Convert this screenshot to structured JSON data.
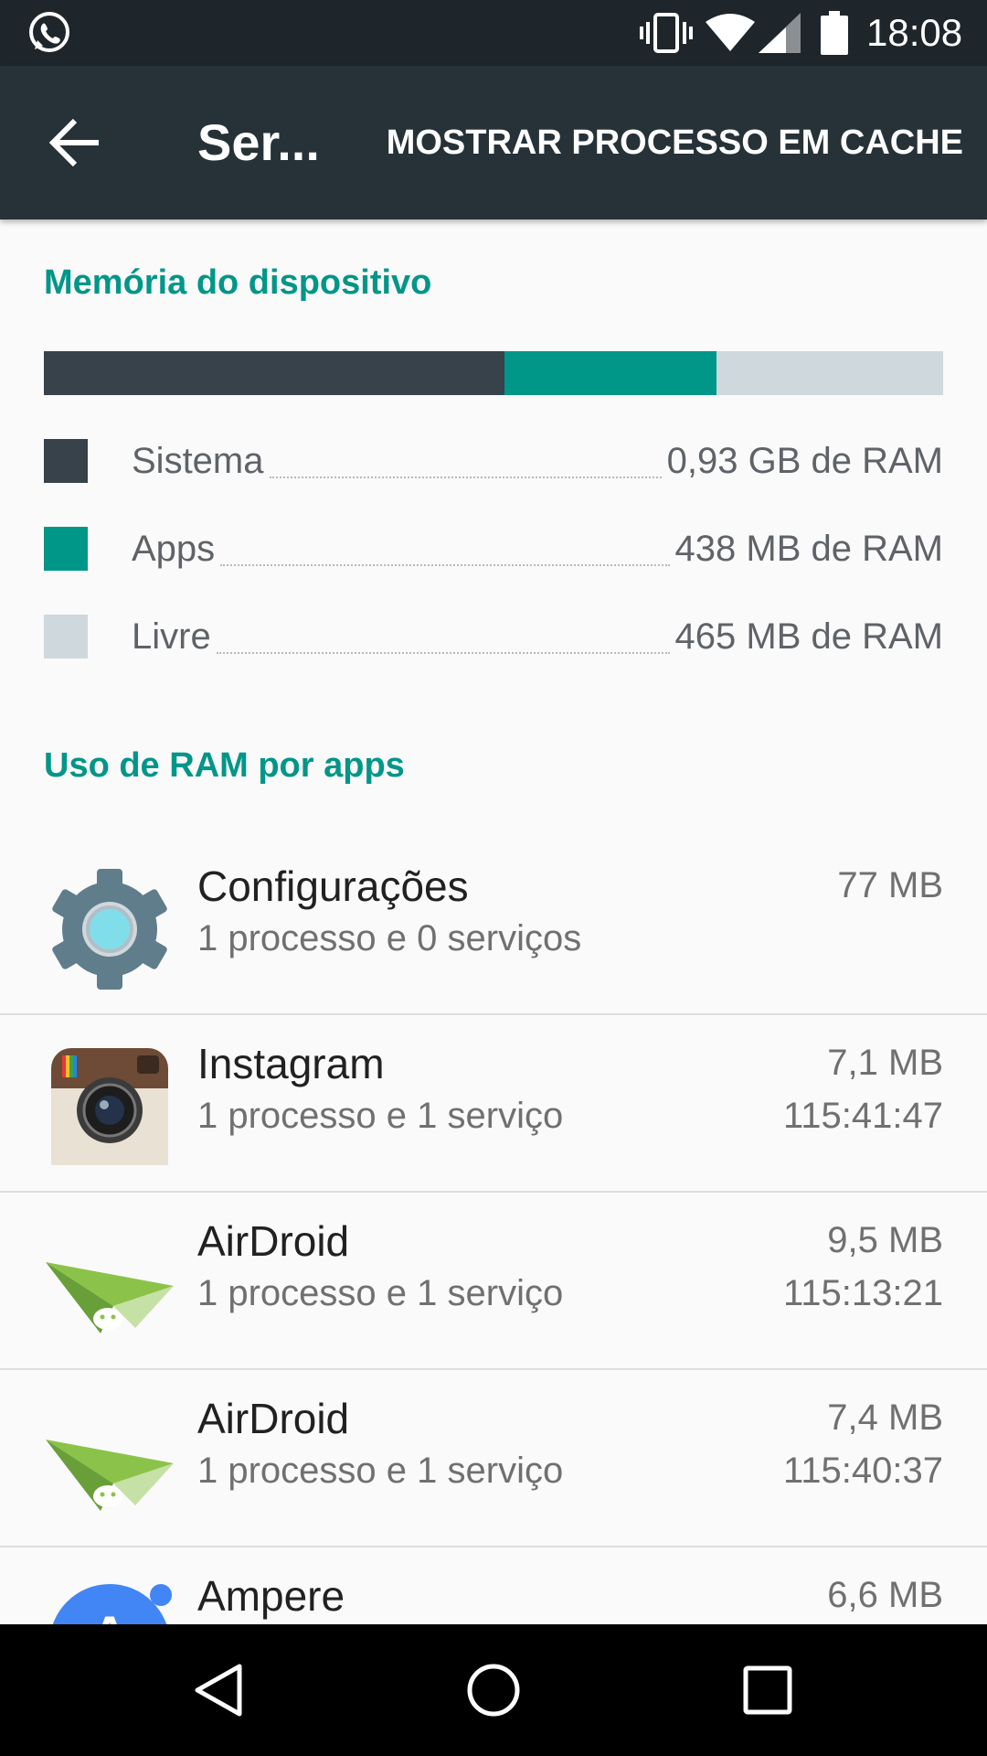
{
  "status_bar": {
    "time": "18:08",
    "icons": [
      "whatsapp-icon",
      "vibrate-icon",
      "wifi-icon",
      "cell-signal-icon",
      "battery-icon"
    ]
  },
  "toolbar": {
    "title": "Ser...",
    "action_label": "MOSTRAR PROCESSO EM CACHE"
  },
  "memory": {
    "section_title": "Memória do dispositivo",
    "legend": [
      {
        "label": "Sistema",
        "value": "0,93 GB de RAM",
        "color": "#37424a"
      },
      {
        "label": "Apps",
        "value": "438 MB de RAM",
        "color": "#009688"
      },
      {
        "label": "Livre",
        "value": "465 MB de RAM",
        "color": "#cfd8dc"
      }
    ],
    "bar_fractions": [
      0.512,
      0.236,
      0.252
    ]
  },
  "apps": {
    "section_title": "Uso de RAM por apps",
    "items": [
      {
        "name": "Configurações",
        "sub": "1 processo e 0 serviços",
        "size": "77 MB",
        "time": "",
        "icon": "settings-gear-icon"
      },
      {
        "name": "Instagram",
        "sub": "1 processo e 1 serviço",
        "size": "7,1 MB",
        "time": "115:41:47",
        "icon": "instagram-icon"
      },
      {
        "name": "AirDroid",
        "sub": "1 processo e 1 serviço",
        "size": "9,5 MB",
        "time": "115:13:21",
        "icon": "airdroid-icon"
      },
      {
        "name": "AirDroid",
        "sub": "1 processo e 1 serviço",
        "size": "7,4 MB",
        "time": "115:40:37",
        "icon": "airdroid-icon"
      },
      {
        "name": "Ampere",
        "sub": "",
        "size": "6,6 MB",
        "time": "",
        "icon": "ampere-icon"
      }
    ]
  },
  "nav_bar": {
    "buttons": [
      "back-triangle-icon",
      "home-circle-icon",
      "recents-square-icon"
    ]
  },
  "colors": {
    "accent": "#009688",
    "toolbar": "#263238",
    "status_bar": "#1e262b"
  }
}
